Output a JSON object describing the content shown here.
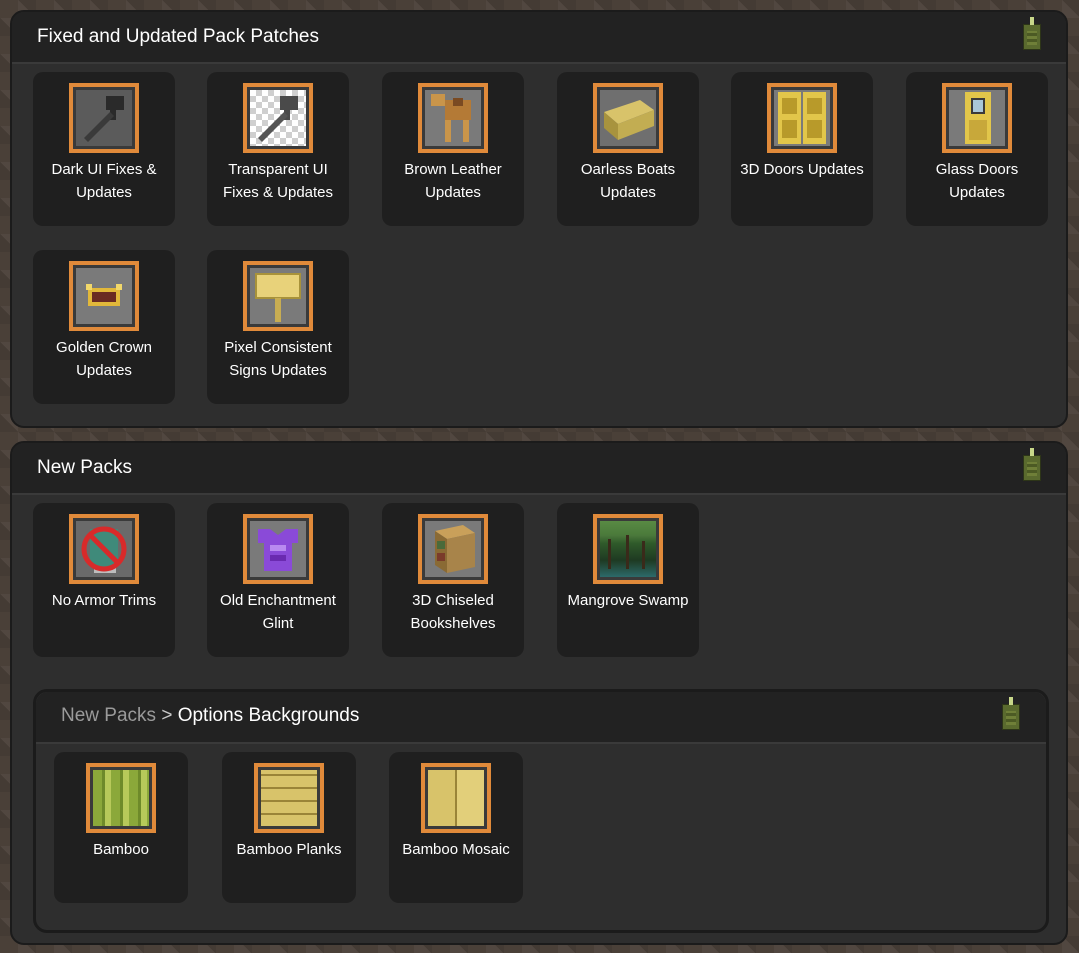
{
  "sections": [
    {
      "title": "Fixed and Updated Pack Patches",
      "tiles": [
        {
          "label": "Dark UI Fixes & Updates",
          "icon": "dark-hammer-icon"
        },
        {
          "label": "Transparent UI Fixes & Updates",
          "icon": "transparent-hammer-icon"
        },
        {
          "label": "Brown Leather Updates",
          "icon": "camel-icon"
        },
        {
          "label": "Oarless Boats Updates",
          "icon": "boat-icon"
        },
        {
          "label": "3D Doors Updates",
          "icon": "double-door-icon"
        },
        {
          "label": "Glass Doors Updates",
          "icon": "glass-door-icon"
        },
        {
          "label": "Golden Crown Updates",
          "icon": "crown-icon"
        },
        {
          "label": "Pixel Consistent Signs Updates",
          "icon": "sign-icon"
        }
      ]
    },
    {
      "title": "New Packs",
      "tiles": [
        {
          "label": "No Armor Trims",
          "icon": "no-armor-trims-icon"
        },
        {
          "label": "Old Enchantment Glint",
          "icon": "enchanted-chestplate-icon"
        },
        {
          "label": "3D Chiseled Bookshelves",
          "icon": "bookshelf-icon"
        },
        {
          "label": "Mangrove Swamp",
          "icon": "swamp-icon"
        }
      ],
      "subsection": {
        "breadcrumb_parent": "New Packs",
        "breadcrumb_separator": ">",
        "breadcrumb_current": "Options Backgrounds",
        "tiles": [
          {
            "label": "Bamboo",
            "icon": "bamboo-icon"
          },
          {
            "label": "Bamboo Planks",
            "icon": "bamboo-planks-icon"
          },
          {
            "label": "Bamboo Mosaic",
            "icon": "bamboo-mosaic-icon"
          }
        ]
      }
    }
  ],
  "colors": {
    "accent_border": "#e08a3a",
    "panel": "#2e2e2e",
    "tile": "#1f1f1f",
    "header": "#222222",
    "text": "#ffffff",
    "breadcrumb_dim": "#9a9a9a"
  }
}
